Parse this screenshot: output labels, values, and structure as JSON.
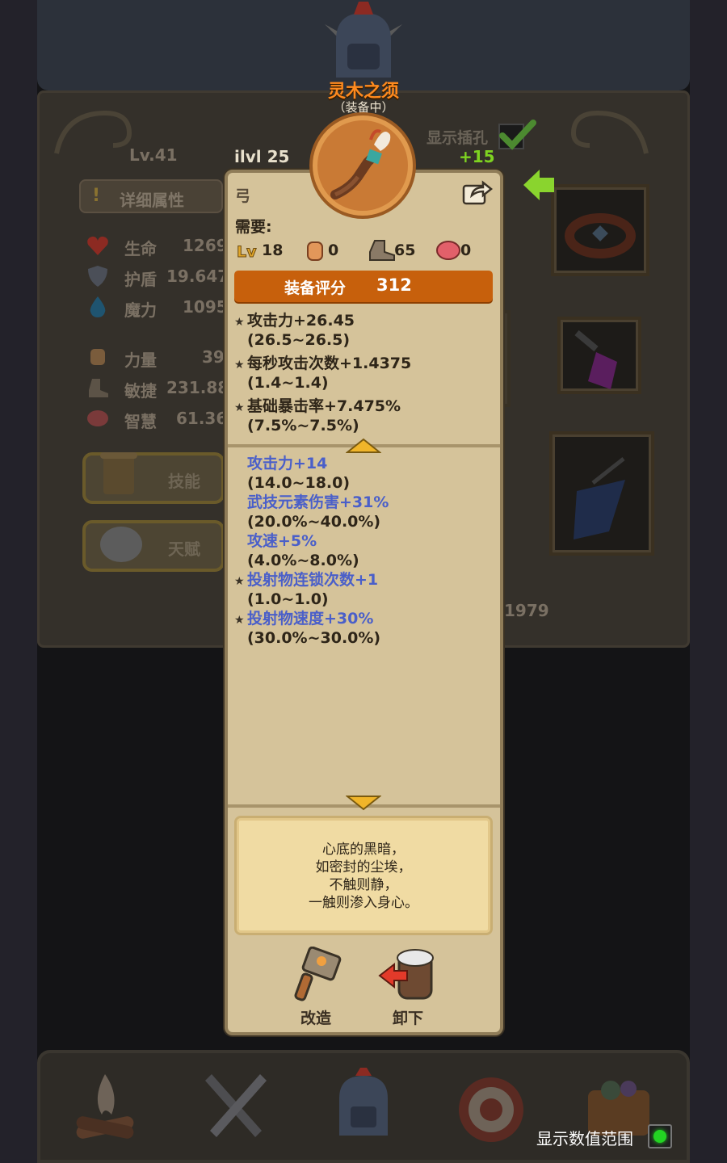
{
  "background": {
    "character_level": "Lv.41",
    "detail_button": "详细属性",
    "stats": [
      {
        "label": "生命",
        "value": "1269",
        "icon": "heart-icon"
      },
      {
        "label": "护盾",
        "value": "19.647",
        "icon": "shield-icon"
      },
      {
        "label": "魔力",
        "value": "1095",
        "icon": "mana-drop-icon"
      },
      {
        "label": "力量",
        "value": "39",
        "icon": "fist-icon"
      },
      {
        "label": "敏捷",
        "value": "231.88",
        "icon": "boot-icon"
      },
      {
        "label": "智慧",
        "value": "61.36",
        "icon": "brain-icon"
      }
    ],
    "skill_button": "技能",
    "talent_button": "天赋",
    "hidden_number": "1979",
    "show_range_label": "显示数值范围",
    "show_range_on": true
  },
  "item": {
    "name": "灵木之须",
    "status": "（装备中）",
    "ilvl_label": "ilvl",
    "ilvl_value": "25",
    "show_sockets_label": "显示插孔",
    "upgrade_bonus": "+15",
    "type": "弓",
    "requirements_label": "需要:",
    "requirements": {
      "level": "18",
      "strength": "0",
      "dexterity": "65",
      "intelligence": "0"
    },
    "score_label": "装备评分",
    "score_value": "312",
    "base_stats": [
      {
        "text": "攻击力+26.45",
        "range": "(26.5~26.5)",
        "starred": true
      },
      {
        "text": "每秒攻击次数+1.4375",
        "range": "(1.4~1.4)",
        "starred": true
      },
      {
        "text": "基础暴击率+7.475%",
        "range": "(7.5%~7.5%)",
        "starred": true
      }
    ],
    "affixes": [
      {
        "text": "攻击力+14",
        "range": "(14.0~18.0)",
        "starred": false
      },
      {
        "text": "武技元素伤害+31%",
        "range": "(20.0%~40.0%)",
        "starred": false
      },
      {
        "text": "攻速+5%",
        "range": "(4.0%~8.0%)",
        "starred": false
      },
      {
        "text": "投射物连锁次数+1",
        "range": "(1.0~1.0)",
        "starred": true
      },
      {
        "text": "投射物速度+30%",
        "range": "(30.0%~30.0%)",
        "starred": true
      }
    ],
    "flavor_lines": [
      "心底的黑暗，",
      "如密封的尘埃，",
      "不触则静，",
      "一触则渗入身心。"
    ],
    "actions": {
      "reforge": "改造",
      "unequip": "卸下"
    }
  },
  "colors": {
    "item_name": "#ff8a1e",
    "affix_blue": "#4a5fc9",
    "score_bar": "#c7600c",
    "upgrade_green": "#7ed321"
  }
}
